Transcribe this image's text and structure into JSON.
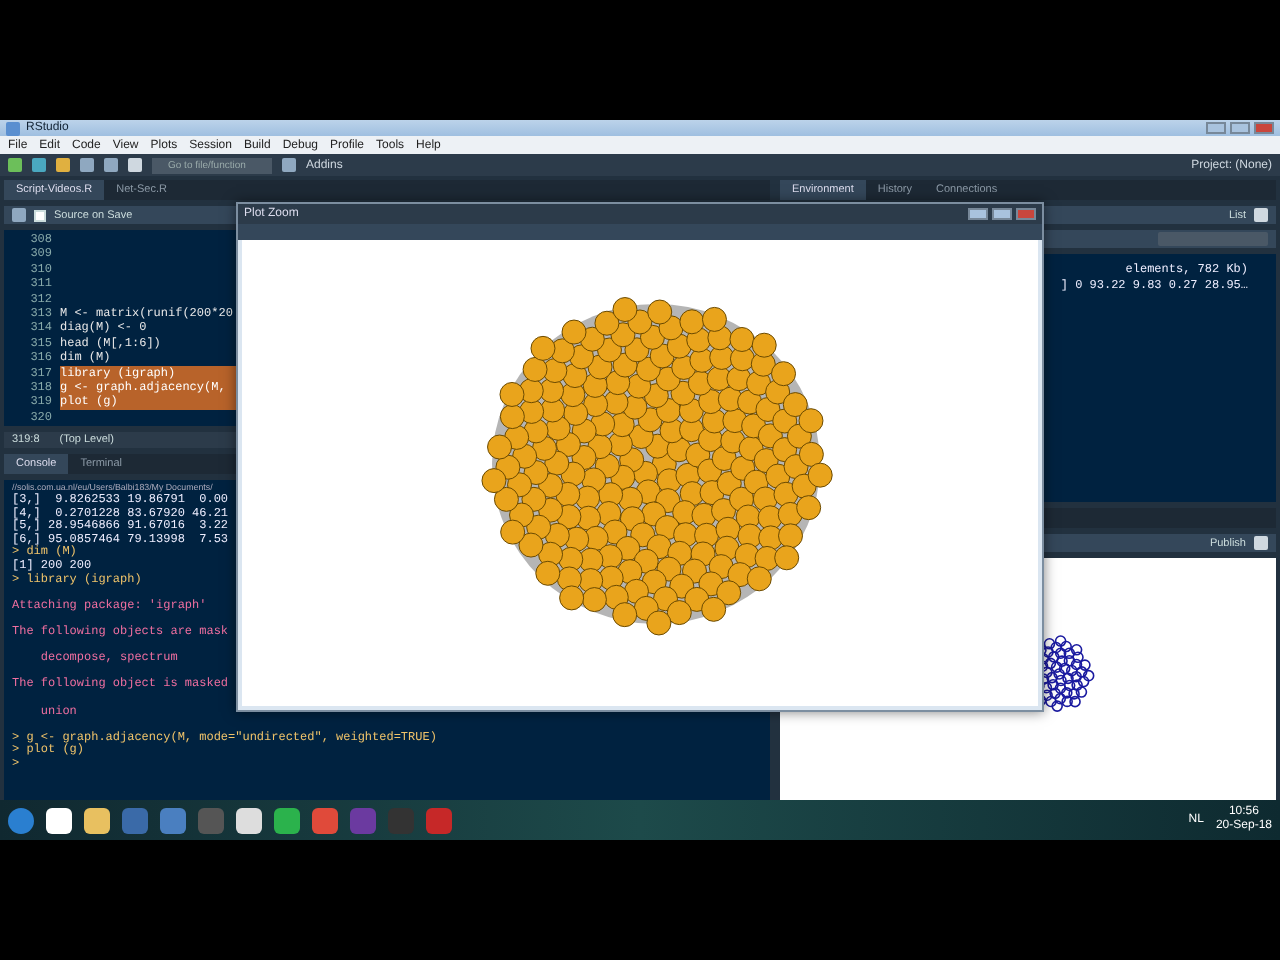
{
  "window": {
    "title": "RStudio"
  },
  "menu": [
    "File",
    "Edit",
    "Code",
    "View",
    "Plots",
    "Session",
    "Build",
    "Debug",
    "Profile",
    "Tools",
    "Help"
  ],
  "toolbar": {
    "goto_placeholder": "Go to file/function",
    "addins": "Addins",
    "project": "Project: (None)"
  },
  "editor": {
    "tabs": [
      {
        "label": "Script-Videos.R",
        "selected": true
      },
      {
        "label": "Net-Sec.R",
        "selected": false
      }
    ],
    "source_on_save": {
      "label": "Source on Save",
      "checked": false
    },
    "lines": [
      {
        "number": "308",
        "highlighted": false
      },
      {
        "number": "309",
        "highlighted": false
      },
      {
        "number": "310",
        "highlighted": false
      },
      {
        "number": "311",
        "highlighted": false
      },
      {
        "number": "312",
        "highlighted": false
      },
      {
        "number": "313",
        "code": "M <- matrix(runif(200*20",
        "highlighted": false
      },
      {
        "number": "314",
        "code": "diag(M) <- 0",
        "highlighted": false
      },
      {
        "number": "315",
        "code": "head (M[,1:6])",
        "highlighted": false
      },
      {
        "number": "316",
        "code": "dim (M)",
        "highlighted": false
      },
      {
        "number": "317",
        "code": "library (igraph)",
        "highlighted": true
      },
      {
        "number": "318",
        "code": "g <- graph.adjacency(M,",
        "highlighted": true
      },
      {
        "number": "319",
        "code": "plot (g)",
        "highlighted": true
      },
      {
        "number": "320",
        "highlighted": false
      }
    ],
    "status": {
      "position": "319:8",
      "scope": "(Top Level)"
    }
  },
  "console": {
    "tabs": [
      {
        "label": "Console",
        "selected": true
      },
      {
        "label": "Terminal",
        "selected": false
      }
    ],
    "path": "//solis.com.ua.nl/eu/Users/Balbi183/My Documents/",
    "lines": [
      {
        "kind": "output",
        "text": "[3,]  9.8262533 19.86791  0.00"
      },
      {
        "kind": "output",
        "text": "[4,]  0.2701228 83.67920 46.21"
      },
      {
        "kind": "output",
        "text": "[5,] 28.9546866 91.67016  3.22"
      },
      {
        "kind": "output",
        "text": "[6,] 95.0857464 79.13998  7.53"
      },
      {
        "kind": "command",
        "text": "> dim (M)"
      },
      {
        "kind": "output",
        "text": "[1] 200 200"
      },
      {
        "kind": "command",
        "text": "> library (igraph)"
      },
      {
        "kind": "blank"
      },
      {
        "kind": "message",
        "text": "Attaching package: 'igraph'"
      },
      {
        "kind": "blank"
      },
      {
        "kind": "message",
        "text": "The following objects are mask"
      },
      {
        "kind": "blank"
      },
      {
        "kind": "message",
        "text": "    decompose, spectrum"
      },
      {
        "kind": "blank"
      },
      {
        "kind": "message",
        "text": "The following object is masked"
      },
      {
        "kind": "blank"
      },
      {
        "kind": "message",
        "text": "    union"
      },
      {
        "kind": "blank"
      },
      {
        "kind": "command",
        "text": "> g <- graph.adjacency(M, mode=\"undirected\", weighted=TRUE)"
      },
      {
        "kind": "command",
        "text": "> plot (g)"
      },
      {
        "kind": "command",
        "text": ">"
      }
    ]
  },
  "environment": {
    "tabs": [
      {
        "label": "Environment",
        "selected": true
      },
      {
        "label": "History",
        "selected": false
      },
      {
        "label": "Connections",
        "selected": false
      }
    ],
    "view": "List",
    "lines": [
      "elements, 782 Kb)",
      "] 0 93.22 9.83 0.27 28.95…"
    ]
  },
  "plots": {
    "publish": "Publish"
  },
  "plot_zoom": {
    "title": "Plot Zoom"
  },
  "taskbar": {
    "language": "NL",
    "time": "10:56",
    "date": "20-Sep-18"
  }
}
